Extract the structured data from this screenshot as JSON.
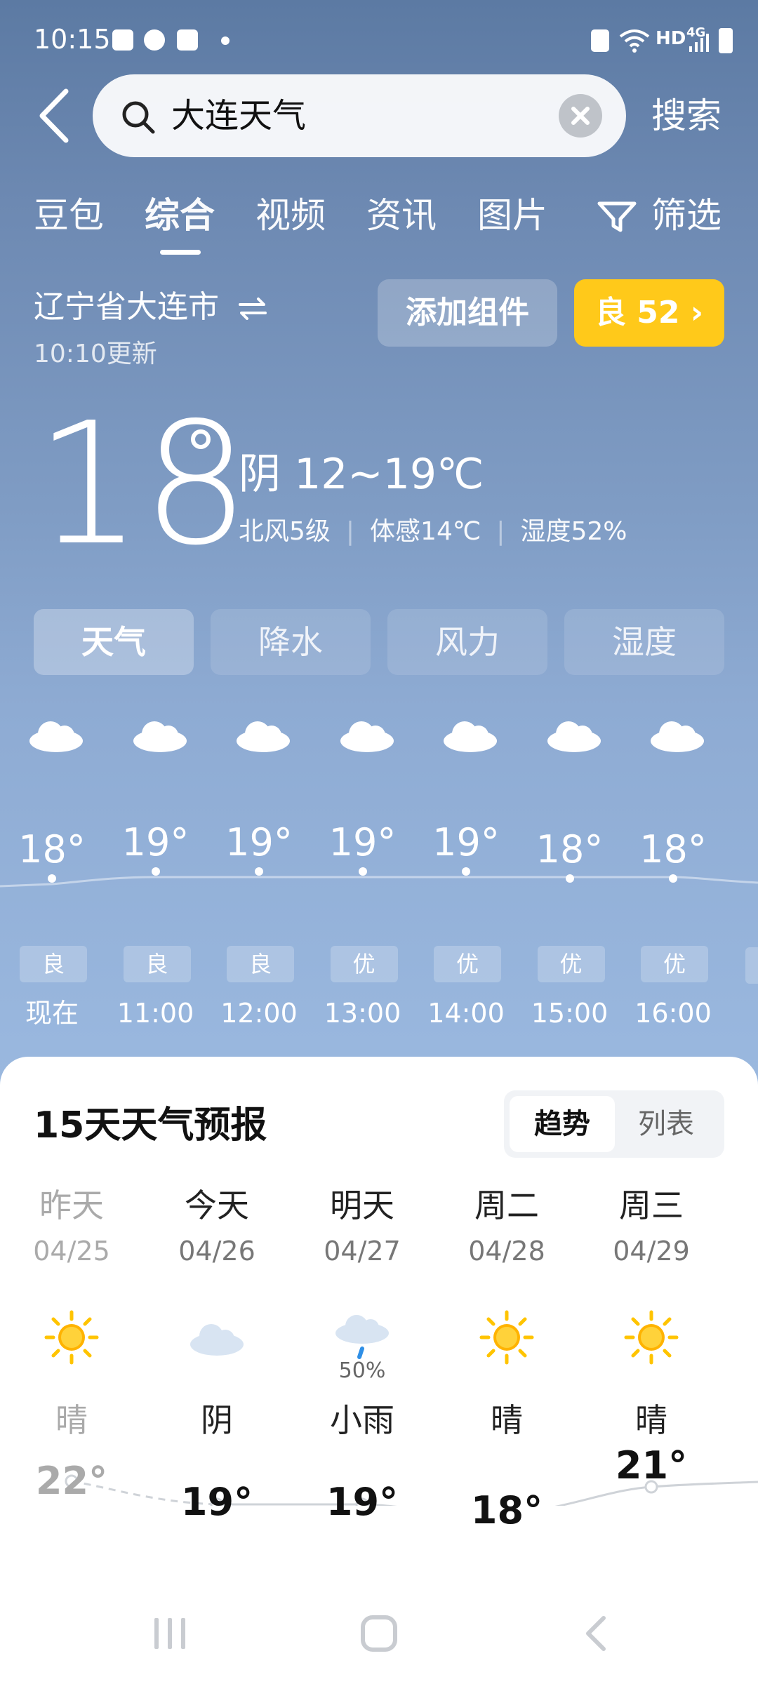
{
  "status_bar": {
    "time": "10:15",
    "network": "HD",
    "signal": "4G"
  },
  "search": {
    "query": "大连天气",
    "submit_label": "搜索"
  },
  "tabs": [
    {
      "label": "豆包"
    },
    {
      "label": "综合",
      "active": true
    },
    {
      "label": "视频"
    },
    {
      "label": "资讯"
    },
    {
      "label": "图片"
    },
    {
      "label": "筛选",
      "icon": "filter-icon"
    }
  ],
  "location": {
    "name": "辽宁省大连市",
    "updated": "10:10更新",
    "add_widget_label": "添加组件",
    "aqi_label": "良 52"
  },
  "current": {
    "temp": "18",
    "condition_range": "阴  12~19℃",
    "wind": "北风5级",
    "feels_like": "体感14℃",
    "humidity": "湿度52%"
  },
  "metric_tabs": [
    {
      "label": "天气",
      "active": true
    },
    {
      "label": "降水"
    },
    {
      "label": "风力"
    },
    {
      "label": "湿度"
    }
  ],
  "hourly": [
    {
      "time": "现在",
      "temp": "18°",
      "aqi": "良",
      "icon": "cloud-icon"
    },
    {
      "time": "11:00",
      "temp": "19°",
      "aqi": "良",
      "icon": "cloud-icon"
    },
    {
      "time": "12:00",
      "temp": "19°",
      "aqi": "良",
      "icon": "cloud-icon"
    },
    {
      "time": "13:00",
      "temp": "19°",
      "aqi": "优",
      "icon": "cloud-icon"
    },
    {
      "time": "14:00",
      "temp": "19°",
      "aqi": "优",
      "icon": "cloud-icon"
    },
    {
      "time": "15:00",
      "temp": "18°",
      "aqi": "优",
      "icon": "cloud-icon"
    },
    {
      "time": "16:00",
      "temp": "18°",
      "aqi": "优",
      "icon": "cloud-icon"
    }
  ],
  "forecast": {
    "title": "15天天气预报",
    "toggle": {
      "trend": "趋势",
      "list": "列表"
    },
    "days": [
      {
        "name": "昨天",
        "date": "04/25",
        "condition": "晴",
        "high": "22°",
        "icon": "sun-icon",
        "past": true
      },
      {
        "name": "今天",
        "date": "04/26",
        "condition": "阴",
        "high": "19°",
        "icon": "cloud-icon"
      },
      {
        "name": "明天",
        "date": "04/27",
        "condition": "小雨",
        "high": "19°",
        "icon": "rain-icon",
        "pop": "50%"
      },
      {
        "name": "周二",
        "date": "04/28",
        "condition": "晴",
        "high": "18°",
        "icon": "sun-icon"
      },
      {
        "name": "周三",
        "date": "04/29",
        "condition": "晴",
        "high": "21°",
        "icon": "sun-icon"
      }
    ]
  },
  "colors": {
    "aqi_badge": "#ffc91a",
    "card_bg": "#ffffff"
  }
}
